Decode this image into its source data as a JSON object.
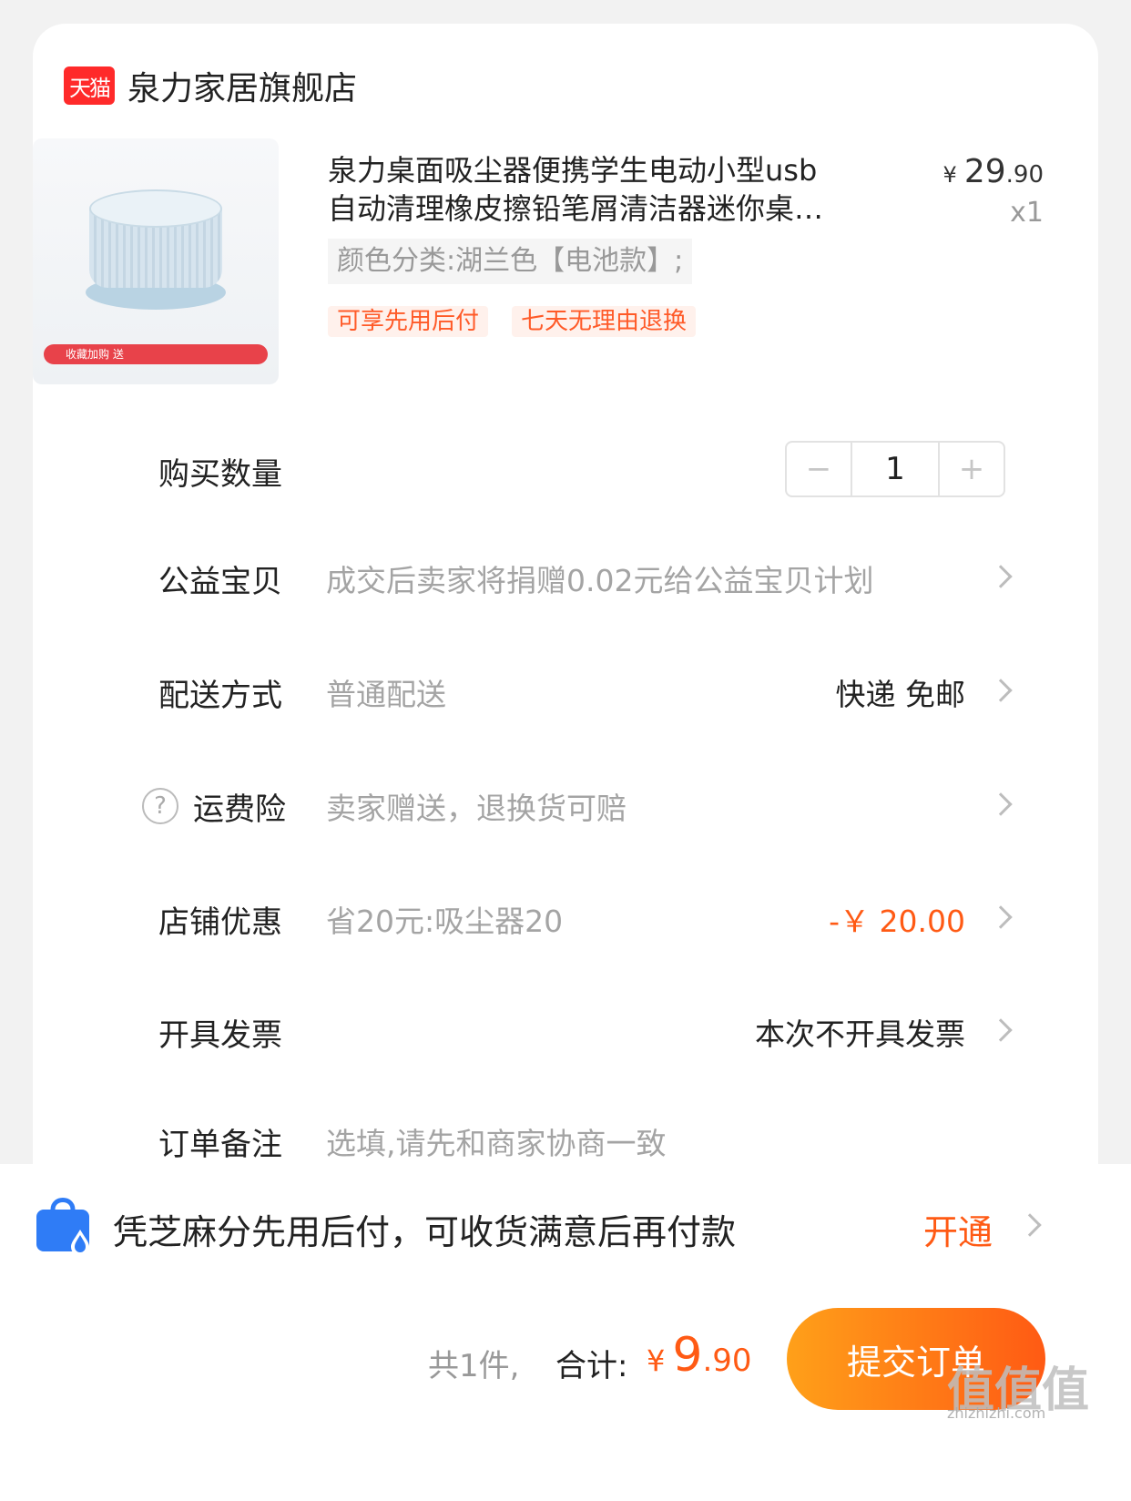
{
  "shop": {
    "platform_badge": "天猫",
    "name": "泉力家居旗舰店"
  },
  "product": {
    "image_promo_text": "收藏加购 送",
    "title_line1": "泉力桌面吸尘器便携学生电动小型usb",
    "title_line2": "自动清理橡皮擦铅笔屑清洁器迷你桌…",
    "price_symbol": "¥",
    "price_main": "29",
    "price_decimal": ".90",
    "quantity_label": "x1",
    "sku": "颜色分类:湖兰色【电池款】;",
    "tags": [
      "可享先用后付",
      "七天无理由退换"
    ]
  },
  "rows": {
    "quantity": {
      "label": "购买数量",
      "minus": "−",
      "value": "1",
      "plus": "+"
    },
    "charity": {
      "label": "公益宝贝",
      "desc": "成交后卖家将捐赠0.02元给公益宝贝计划"
    },
    "delivery": {
      "label": "配送方式",
      "desc": "普通配送",
      "value": "快递 免邮"
    },
    "insurance": {
      "help_icon": "?",
      "label": "运费险",
      "desc": "卖家赠送，退换货可赔"
    },
    "discount": {
      "label": "店铺优惠",
      "desc": "省20元:吸尘器20",
      "value": "-￥ 20.00"
    },
    "invoice": {
      "label": "开具发票",
      "value": "本次不开具发票"
    },
    "note": {
      "label": "订单备注",
      "placeholder": "选填,请先和商家协商一致"
    }
  },
  "pay_later": {
    "text": "凭芝麻分先用后付，可收货满意后再付款",
    "action": "开通"
  },
  "checkout": {
    "count": "共1件,",
    "total_label": "合计:",
    "currency": "¥",
    "total_main": "9",
    "total_decimal": ".90",
    "submit": "提交订单"
  },
  "watermark": {
    "text": "值值值",
    "url": "zhizhizhi.com"
  },
  "colors": {
    "accent": "#ff5a14",
    "tmall_red": "#ff2a2a",
    "tag_bg": "#fff1ec"
  }
}
